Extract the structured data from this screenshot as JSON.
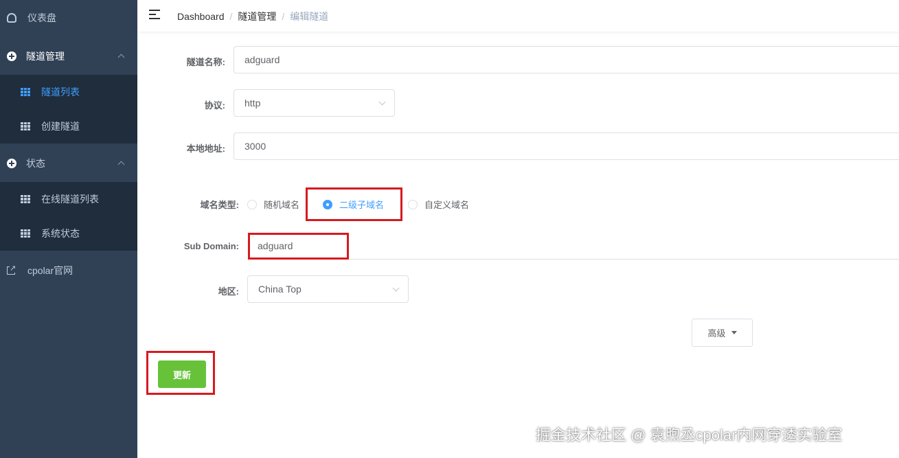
{
  "sidebar": {
    "dashboard": "仪表盘",
    "tunnel_mgmt": "隧道管理",
    "tunnel_list": "隧道列表",
    "create_tunnel": "创建隧道",
    "status": "状态",
    "online_tunnels": "在线隧道列表",
    "system_status": "系统状态",
    "website": "cpolar官网"
  },
  "breadcrumb": {
    "home": "Dashboard",
    "parent": "隧道管理",
    "current": "编辑隧道",
    "separator": "/"
  },
  "form": {
    "name_label": "隧道名称:",
    "name_value": "adguard",
    "protocol_label": "协议:",
    "protocol_value": "http",
    "local_addr_label": "本地地址:",
    "local_addr_value": "3000",
    "domain_type_label": "域名类型:",
    "domain_options": [
      "随机域名",
      "二级子域名",
      "自定义域名"
    ],
    "domain_selected": "二级子域名",
    "subdomain_label": "Sub Domain:",
    "subdomain_value": "adguard",
    "region_label": "地区:",
    "region_value": "China Top",
    "advanced_button": "高级",
    "update_button": "更新"
  },
  "watermark": "掘金技术社区 @ 袁煦丞cpolar内网穿透实验室",
  "colors": {
    "sidebar_bg": "#304156",
    "submenu_bg": "#1f2d3d",
    "active": "#409eff",
    "success": "#67c23a",
    "highlight": "#d7191f"
  }
}
